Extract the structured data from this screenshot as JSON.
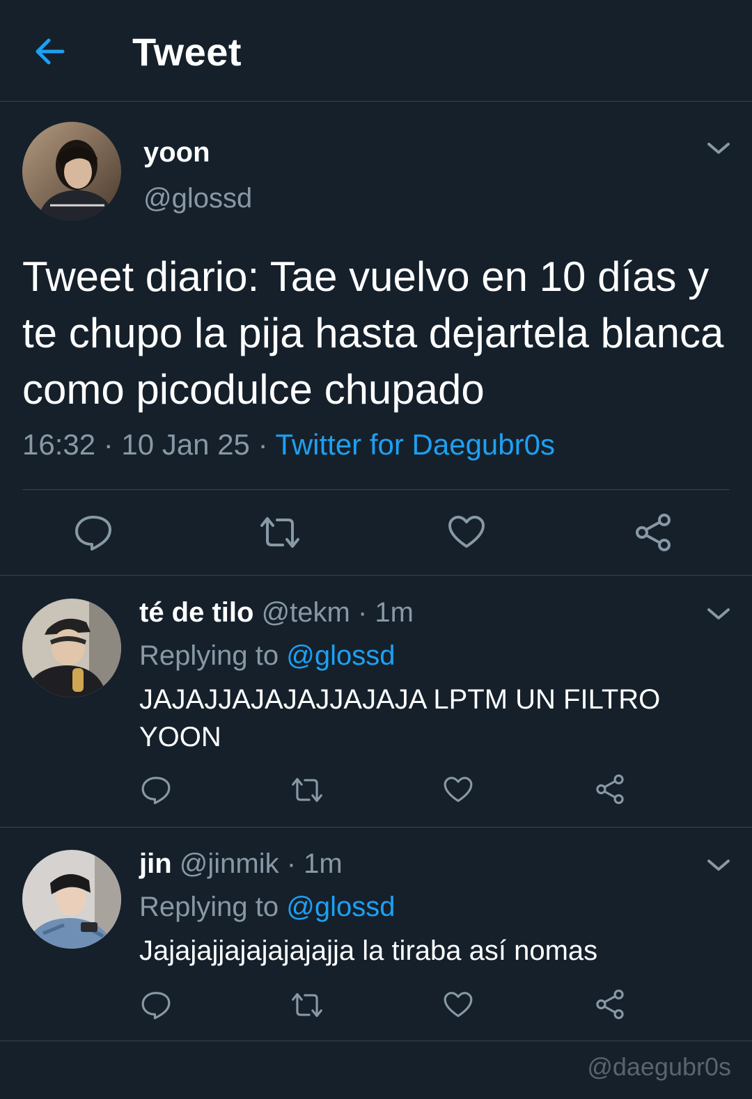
{
  "header": {
    "title": "Tweet"
  },
  "tweet": {
    "name": "yoon",
    "handle": "@glossd",
    "text": "Tweet diario: Tae vuelvo en 10 días y te chupo la pija hasta dejartela blanca como picodulce chupado",
    "time": "16:32 · 10 Jan 25 · ",
    "source": "Twitter for Daegubr0s"
  },
  "replies": [
    {
      "name": "té de tilo",
      "meta": " @tekm · 1m",
      "replying_prefix": "Replying to ",
      "replying_handle": "@glossd",
      "text": "JAJAJJAJAJAJJAJAJA LPTM UN FILTRO YOON"
    },
    {
      "name": "jin",
      "meta": " @jinmik · 1m",
      "replying_prefix": "Replying to ",
      "replying_handle": "@glossd",
      "text": "Jajajajjajajajajajja la tiraba así nomas"
    }
  ],
  "watermark": "@daegubr0s",
  "colors": {
    "background": "#15202b",
    "accent": "#1da1f2",
    "secondary_text": "#8899a6",
    "border": "#38444d"
  },
  "icons": [
    "back-arrow-icon",
    "chevron-down-icon",
    "reply-icon",
    "retweet-icon",
    "like-icon",
    "share-icon"
  ]
}
